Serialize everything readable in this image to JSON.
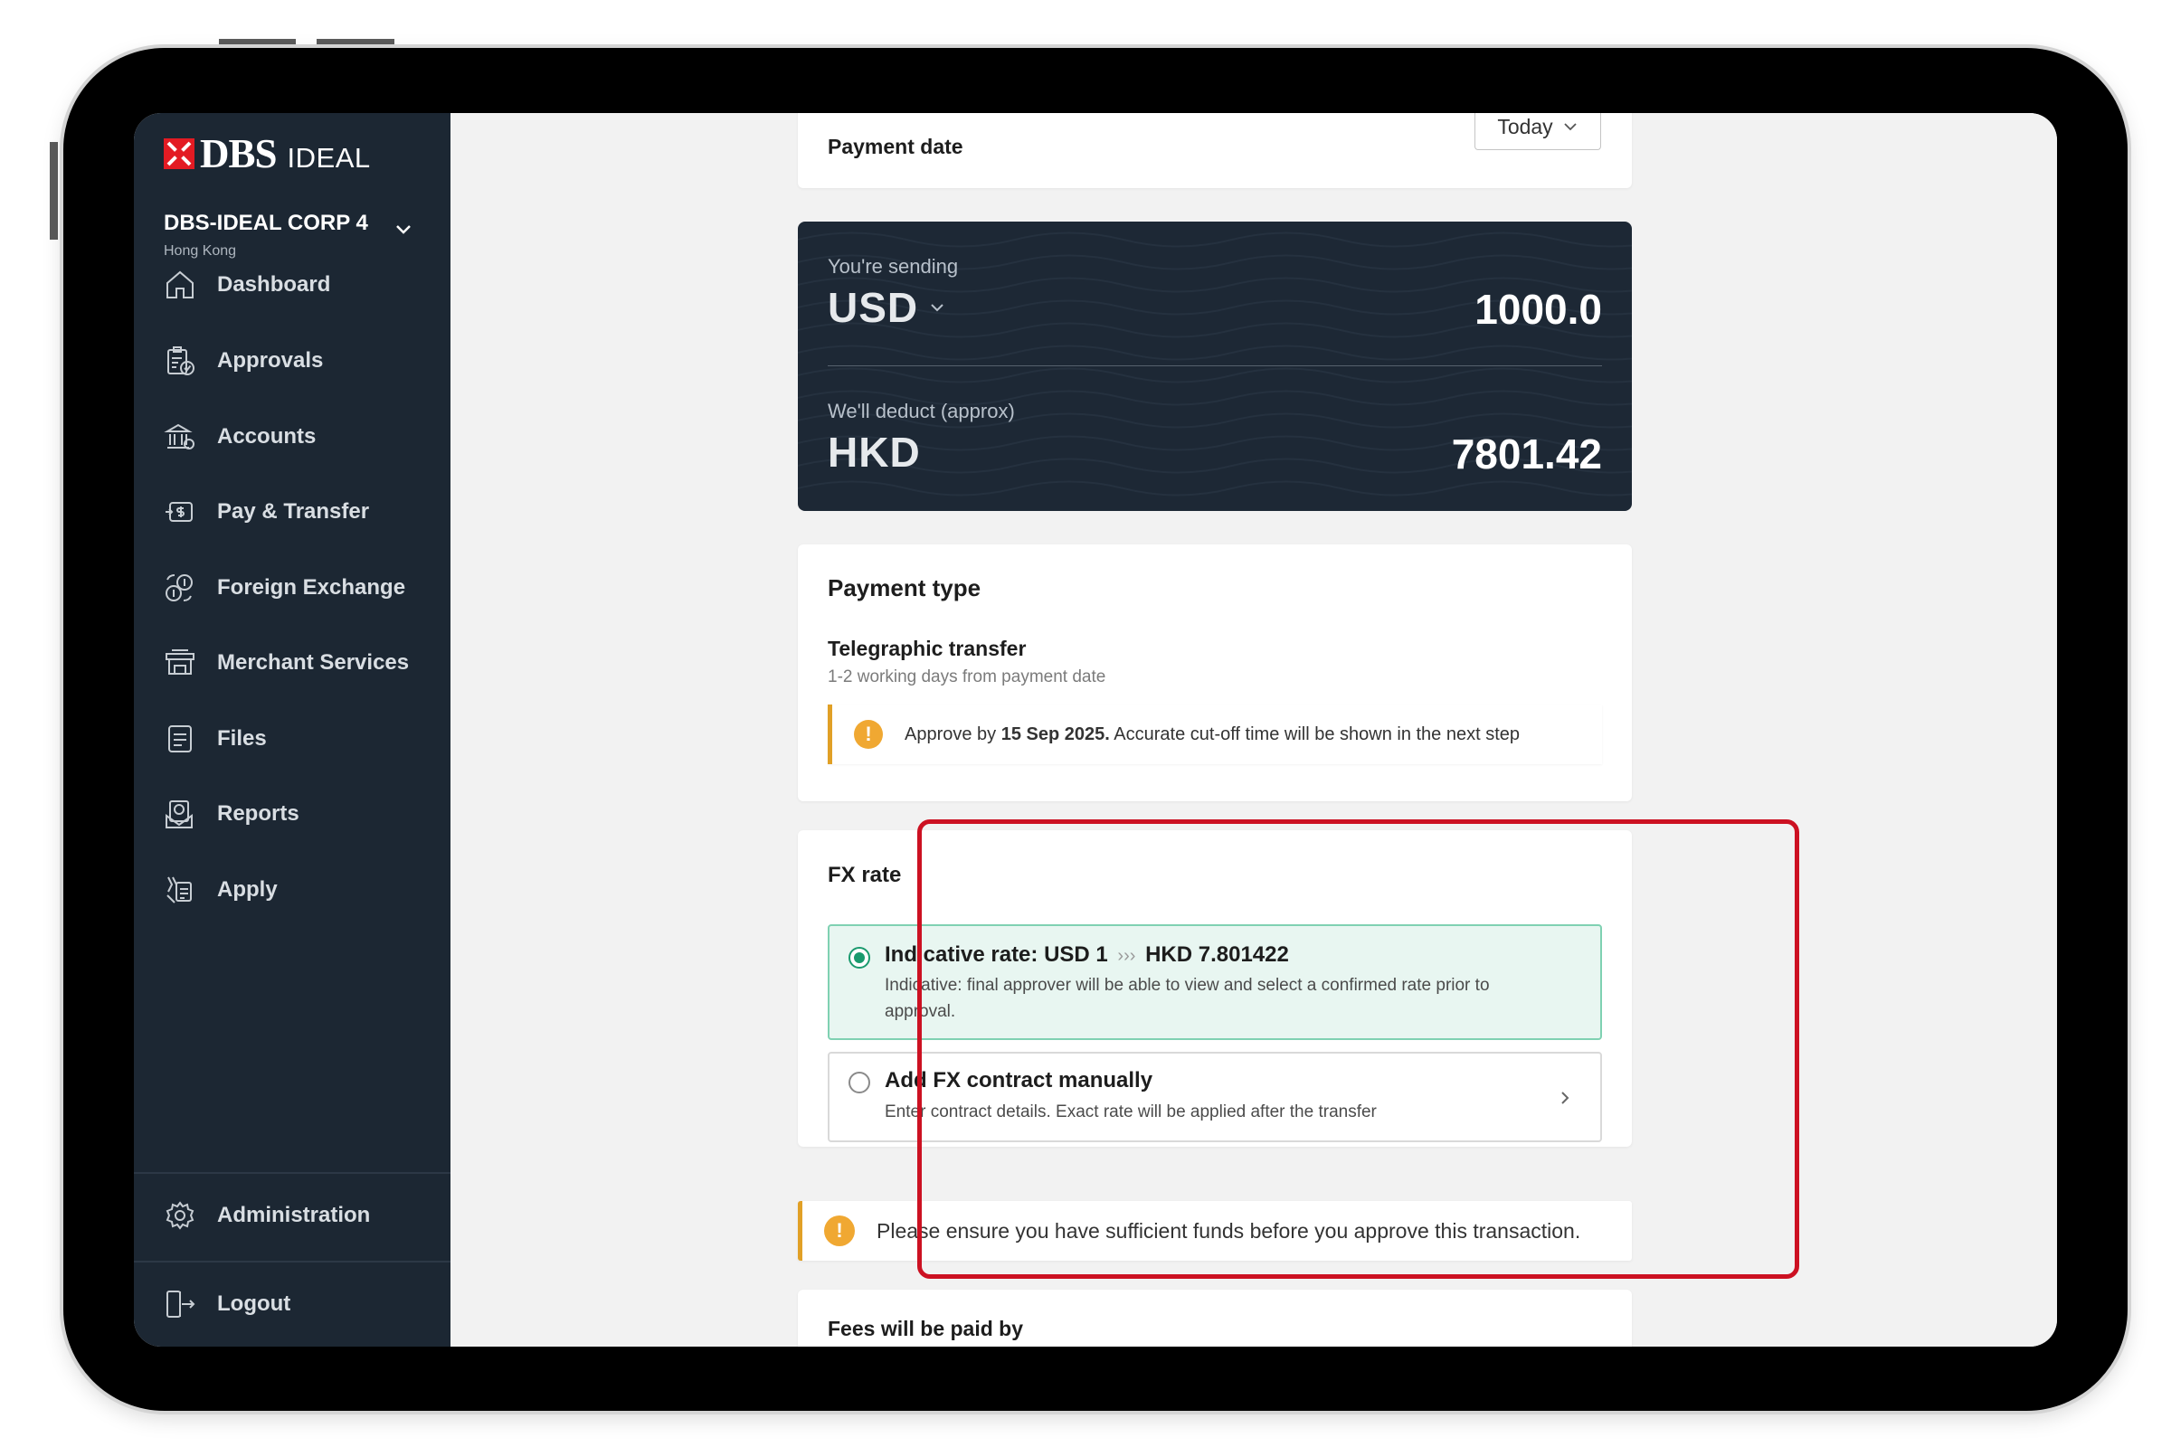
{
  "sidebar": {
    "brand": "DBS",
    "product": "IDEAL",
    "company": "DBS-IDEAL CORP 4",
    "region": "Hong Kong",
    "items": [
      {
        "label": "Dashboard",
        "icon": "home-icon"
      },
      {
        "label": "Approvals",
        "icon": "approvals-icon"
      },
      {
        "label": "Accounts",
        "icon": "bank-icon"
      },
      {
        "label": "Pay & Transfer",
        "icon": "pay-transfer-icon"
      },
      {
        "label": "Foreign Exchange",
        "icon": "fx-icon"
      },
      {
        "label": "Merchant Services",
        "icon": "merchant-icon"
      },
      {
        "label": "Files",
        "icon": "file-icon"
      },
      {
        "label": "Reports",
        "icon": "report-icon"
      },
      {
        "label": "Apply",
        "icon": "apply-icon"
      }
    ],
    "admin_label": "Administration",
    "logout_label": "Logout"
  },
  "payment_date": {
    "label": "Payment date",
    "value": "Today"
  },
  "sending": {
    "sending_label": "You're sending",
    "sending_currency": "USD",
    "sending_amount": "1000.0",
    "deduct_label": "We'll deduct (approx)",
    "deduct_currency": "HKD",
    "deduct_amount": "7801.42"
  },
  "payment_type": {
    "heading": "Payment type",
    "method": "Telegraphic transfer",
    "timing": "1-2 working days from payment date",
    "notice_prefix": "Approve by ",
    "notice_date": "15 Sep 2025.",
    "notice_suffix": " Accurate cut-off time will be shown in the next step"
  },
  "fx_rate": {
    "heading": "FX rate",
    "options": [
      {
        "title_prefix": "Indicative rate: USD 1",
        "title_arrows": "›››",
        "title_suffix": "HKD 7.801422",
        "desc_line1": "Indicative: final approver will be able to view and select a confirmed rate prior to",
        "desc_line2": "approval.",
        "selected": true
      },
      {
        "title": "Add FX contract manually",
        "desc": "Enter contract details. Exact rate will be applied after the transfer",
        "selected": false
      }
    ]
  },
  "funds_warning": "Please ensure you have sufficient funds before you approve this transaction.",
  "fees": {
    "label": "Fees will be paid by"
  },
  "colors": {
    "sidebar_bg": "#1c2733",
    "accent_red": "#cc1122",
    "selected_green": "#1a9a6e",
    "warning_orange": "#f0a832"
  }
}
